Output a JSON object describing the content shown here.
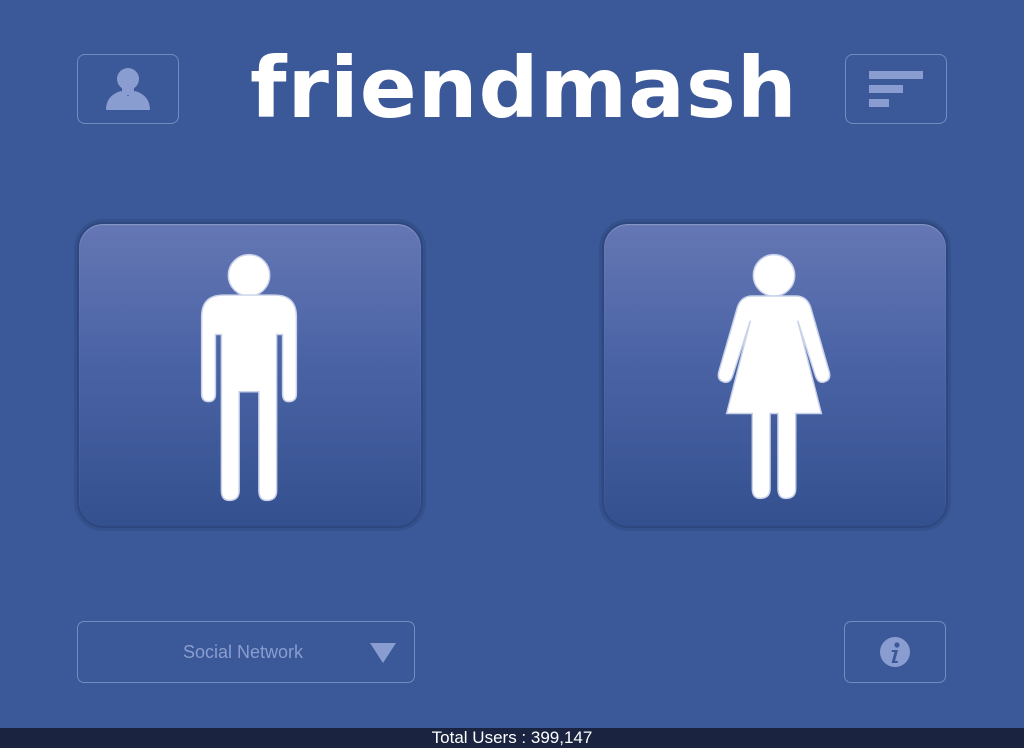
{
  "app": {
    "title": "friendmash"
  },
  "header": {
    "profile_icon": "person-silhouette-icon",
    "rankings_icon": "ranking-bars-icon"
  },
  "gender_choices": [
    {
      "icon": "male-figure-icon"
    },
    {
      "icon": "female-figure-icon"
    }
  ],
  "network_select": {
    "selected": "Social Network",
    "icon": "triangle-down-icon"
  },
  "info": {
    "icon": "info-icon"
  },
  "footer": {
    "total_users_text": "Total Users : 399,147"
  },
  "colors": {
    "background": "#3b5998",
    "button_top": "#6577b4",
    "button_bottom": "#34508e",
    "icon_muted": "#8a9dd0",
    "status_bar": "#1a2440"
  }
}
